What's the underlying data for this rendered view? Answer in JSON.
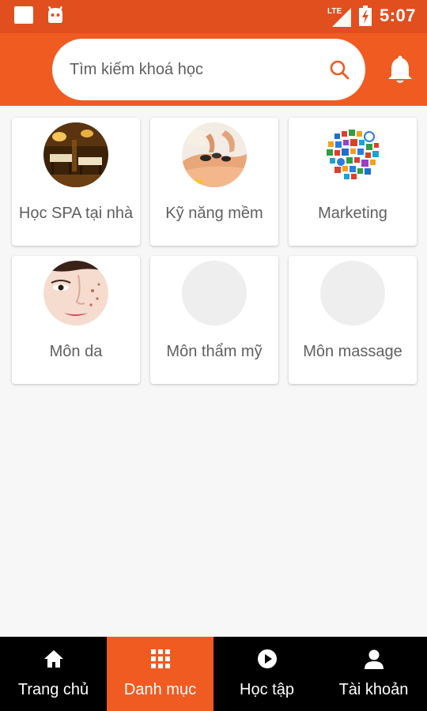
{
  "status_bar": {
    "network": "LTE",
    "time": "5:07",
    "left_icons": [
      "notification-square-icon",
      "android-robot-icon"
    ],
    "right_icons": [
      "lte-signal-icon",
      "battery-charging-icon"
    ]
  },
  "header": {
    "search_placeholder": "Tìm kiếm khoá học",
    "search_icon": "search-icon",
    "bell_icon": "bell-icon",
    "background_color": "#f05b22"
  },
  "categories": [
    {
      "label": "Học SPA tại nhà",
      "thumbnail": "spa-room-photo"
    },
    {
      "label": "Kỹ năng mềm",
      "thumbnail": "massage-stones-photo"
    },
    {
      "label": "Marketing",
      "thumbnail": "marketing-icons-cloud"
    },
    {
      "label": "Môn da",
      "thumbnail": "skin-face-photo"
    },
    {
      "label": "Môn thẩm mỹ",
      "thumbnail": "empty-placeholder"
    },
    {
      "label": "Môn massage",
      "thumbnail": "empty-placeholder"
    }
  ],
  "bottom_nav": {
    "items": [
      {
        "label": "Trang chủ",
        "icon": "home-icon",
        "active": false
      },
      {
        "label": "Danh mục",
        "icon": "grid-icon",
        "active": true
      },
      {
        "label": "Học tập",
        "icon": "play-circle-icon",
        "active": false
      },
      {
        "label": "Tài khoản",
        "icon": "user-icon",
        "active": false
      }
    ],
    "active_color": "#f05b22"
  }
}
